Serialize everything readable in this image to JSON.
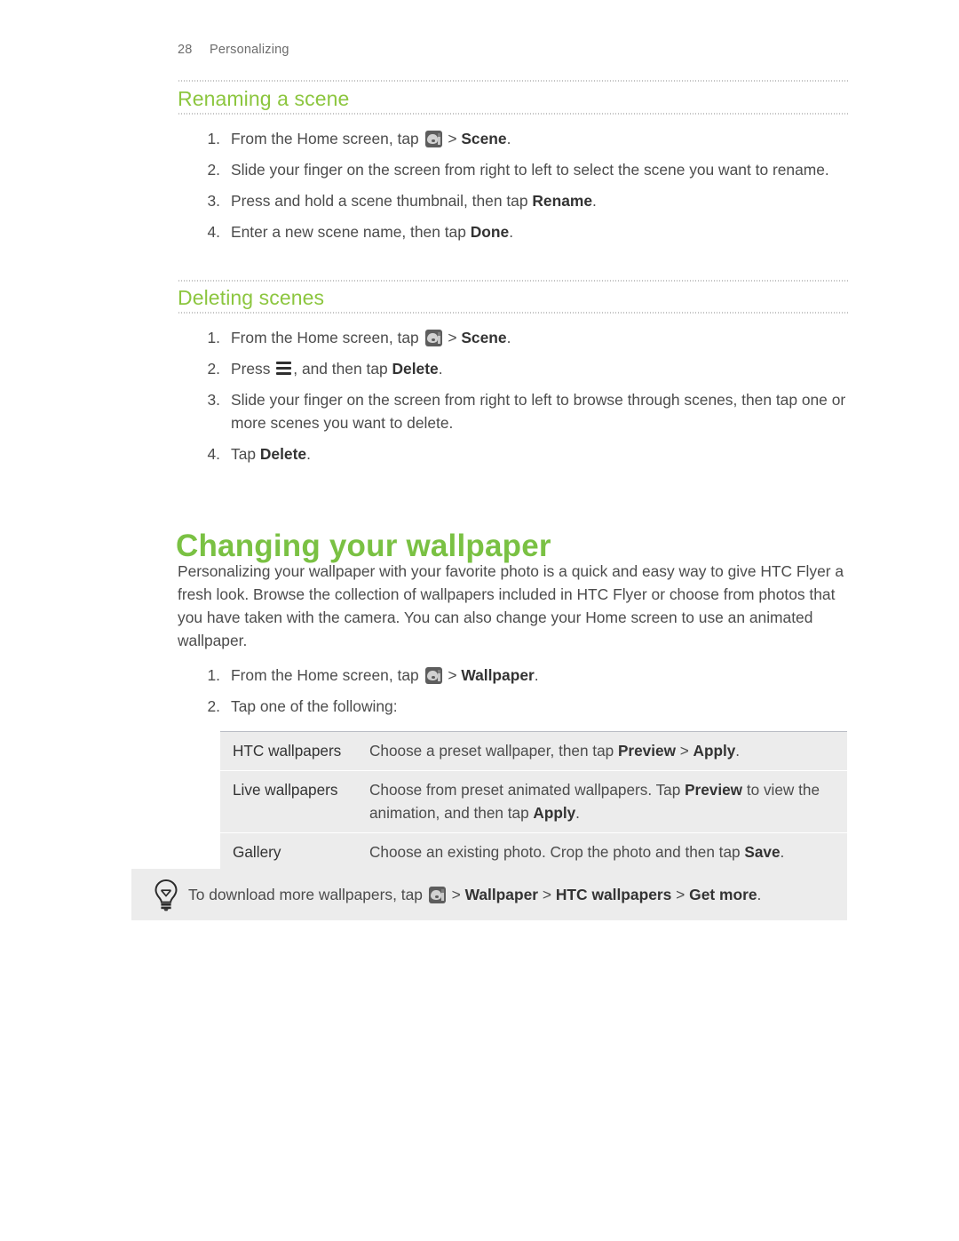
{
  "page": {
    "number": "28",
    "section": "Personalizing"
  },
  "colors": {
    "heading_green": "#7ac143",
    "subheading_green": "#8cc63f",
    "body_text": "#4c4c4c",
    "table_row_bg": "#ececec",
    "tip_bg": "#ececec"
  },
  "sections": [
    {
      "title": "Renaming a scene",
      "steps": [
        {
          "num": "1.",
          "parts": [
            {
              "type": "text",
              "value": "From the Home screen, tap "
            },
            {
              "type": "icon",
              "value": "personalize-icon"
            },
            {
              "type": "text",
              "value": " > "
            },
            {
              "type": "bold",
              "value": "Scene"
            },
            {
              "type": "text",
              "value": "."
            }
          ]
        },
        {
          "num": "2.",
          "parts": [
            {
              "type": "text",
              "value": "Slide your finger on the screen from right to left to select the scene you want to rename."
            }
          ]
        },
        {
          "num": "3.",
          "parts": [
            {
              "type": "text",
              "value": "Press and hold a scene thumbnail, then tap "
            },
            {
              "type": "bold",
              "value": "Rename"
            },
            {
              "type": "text",
              "value": "."
            }
          ]
        },
        {
          "num": "4.",
          "parts": [
            {
              "type": "text",
              "value": "Enter a new scene name, then tap "
            },
            {
              "type": "bold",
              "value": "Done"
            },
            {
              "type": "text",
              "value": "."
            }
          ]
        }
      ]
    },
    {
      "title": "Deleting scenes",
      "steps": [
        {
          "num": "1.",
          "parts": [
            {
              "type": "text",
              "value": "From the Home screen, tap "
            },
            {
              "type": "icon",
              "value": "personalize-icon"
            },
            {
              "type": "text",
              "value": " > "
            },
            {
              "type": "bold",
              "value": "Scene"
            },
            {
              "type": "text",
              "value": "."
            }
          ]
        },
        {
          "num": "2.",
          "parts": [
            {
              "type": "text",
              "value": "Press "
            },
            {
              "type": "icon",
              "value": "menu-icon"
            },
            {
              "type": "text",
              "value": ", and then tap "
            },
            {
              "type": "bold",
              "value": "Delete"
            },
            {
              "type": "text",
              "value": "."
            }
          ]
        },
        {
          "num": "3.",
          "parts": [
            {
              "type": "text",
              "value": "Slide your finger on the screen from right to left to browse through scenes, then tap one or more scenes you want to delete."
            }
          ]
        },
        {
          "num": "4.",
          "parts": [
            {
              "type": "text",
              "value": "Tap "
            },
            {
              "type": "bold",
              "value": "Delete"
            },
            {
              "type": "text",
              "value": "."
            }
          ]
        }
      ]
    }
  ],
  "chapter": {
    "title": "Changing your wallpaper",
    "intro": "Personalizing your wallpaper with your favorite photo is a quick and easy way to give HTC Flyer a fresh look. Browse the collection of wallpapers included in HTC Flyer or choose from photos that you have taken with the camera. You can also change your Home screen to use an animated wallpaper.",
    "steps": [
      {
        "num": "1.",
        "parts": [
          {
            "type": "text",
            "value": "From the Home screen, tap "
          },
          {
            "type": "icon",
            "value": "personalize-icon"
          },
          {
            "type": "text",
            "value": " > "
          },
          {
            "type": "bold",
            "value": "Wallpaper"
          },
          {
            "type": "text",
            "value": "."
          }
        ]
      },
      {
        "num": "2.",
        "parts": [
          {
            "type": "text",
            "value": "Tap one of the following:"
          }
        ]
      }
    ],
    "options_table": {
      "rows": [
        {
          "label": "HTC wallpapers",
          "parts": [
            {
              "type": "text",
              "value": "Choose a preset wallpaper, then tap "
            },
            {
              "type": "bold",
              "value": "Preview"
            },
            {
              "type": "text",
              "value": " > "
            },
            {
              "type": "bold",
              "value": "Apply"
            },
            {
              "type": "text",
              "value": "."
            }
          ]
        },
        {
          "label": "Live wallpapers",
          "parts": [
            {
              "type": "text",
              "value": "Choose from preset animated wallpapers. Tap "
            },
            {
              "type": "bold",
              "value": "Preview"
            },
            {
              "type": "text",
              "value": " to view the animation, and then tap "
            },
            {
              "type": "bold",
              "value": "Apply"
            },
            {
              "type": "text",
              "value": "."
            }
          ]
        },
        {
          "label": "Gallery",
          "parts": [
            {
              "type": "text",
              "value": "Choose an existing photo. Crop the photo and then tap "
            },
            {
              "type": "bold",
              "value": "Save"
            },
            {
              "type": "text",
              "value": "."
            }
          ]
        }
      ]
    },
    "tip": {
      "icon": "lightbulb-icon",
      "parts": [
        {
          "type": "text",
          "value": "To download more wallpapers, tap "
        },
        {
          "type": "icon",
          "value": "personalize-icon"
        },
        {
          "type": "text",
          "value": " > "
        },
        {
          "type": "bold",
          "value": "Wallpaper"
        },
        {
          "type": "text",
          "value": " > "
        },
        {
          "type": "bold",
          "value": "HTC wallpapers"
        },
        {
          "type": "text",
          "value": " > "
        },
        {
          "type": "bold",
          "value": "Get more"
        },
        {
          "type": "text",
          "value": "."
        }
      ]
    }
  }
}
